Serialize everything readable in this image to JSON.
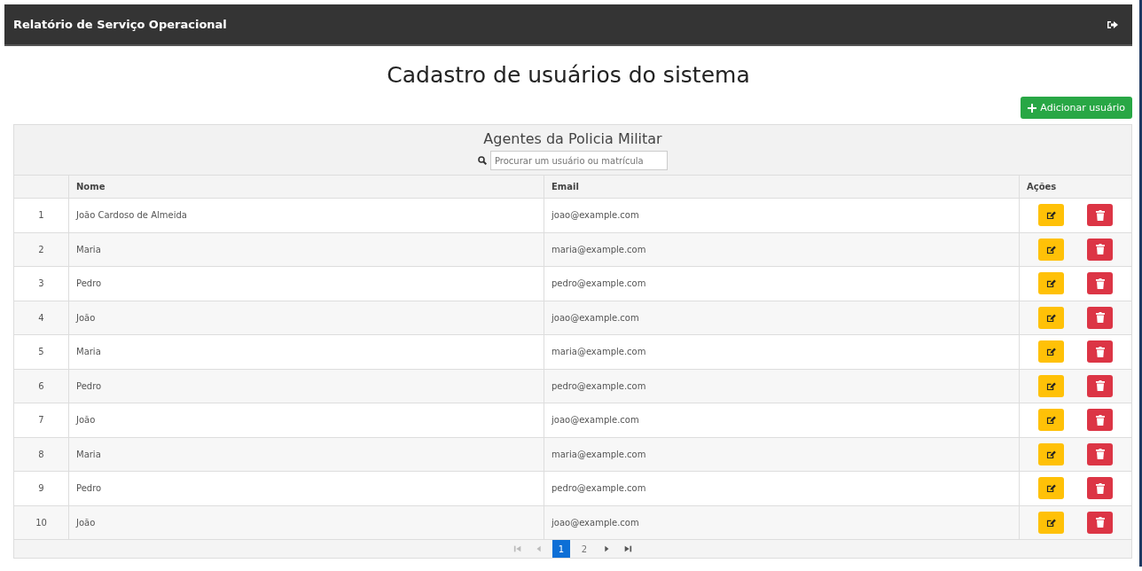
{
  "navbar": {
    "title": "Relatório de Serviço Operacional"
  },
  "page_title": "Cadastro de usuários do sistema",
  "add_button": {
    "label": "Adicionar usuário"
  },
  "table": {
    "caption": "Agentes da Policia Militar",
    "search": {
      "placeholder": "Procurar um usuário ou matrícula"
    },
    "columns": [
      "Nome",
      "Email",
      "Ações"
    ],
    "rows": [
      {
        "index": "1",
        "name": "João Cardoso de Almeida",
        "email": "joao@example.com"
      },
      {
        "index": "2",
        "name": "Maria",
        "email": "maria@example.com"
      },
      {
        "index": "3",
        "name": "Pedro",
        "email": "pedro@example.com"
      },
      {
        "index": "4",
        "name": "João",
        "email": "joao@example.com"
      },
      {
        "index": "5",
        "name": "Maria",
        "email": "maria@example.com"
      },
      {
        "index": "6",
        "name": "Pedro",
        "email": "pedro@example.com"
      },
      {
        "index": "7",
        "name": "João",
        "email": "joao@example.com"
      },
      {
        "index": "8",
        "name": "Maria",
        "email": "maria@example.com"
      },
      {
        "index": "9",
        "name": "Pedro",
        "email": "pedro@example.com"
      },
      {
        "index": "10",
        "name": "João",
        "email": "joao@example.com"
      }
    ]
  },
  "pagination": {
    "first_disabled": true,
    "prev_disabled": true,
    "next_disabled": false,
    "last_disabled": false,
    "pages": [
      {
        "label": "1",
        "selected": true
      },
      {
        "label": "2",
        "selected": false
      }
    ]
  }
}
